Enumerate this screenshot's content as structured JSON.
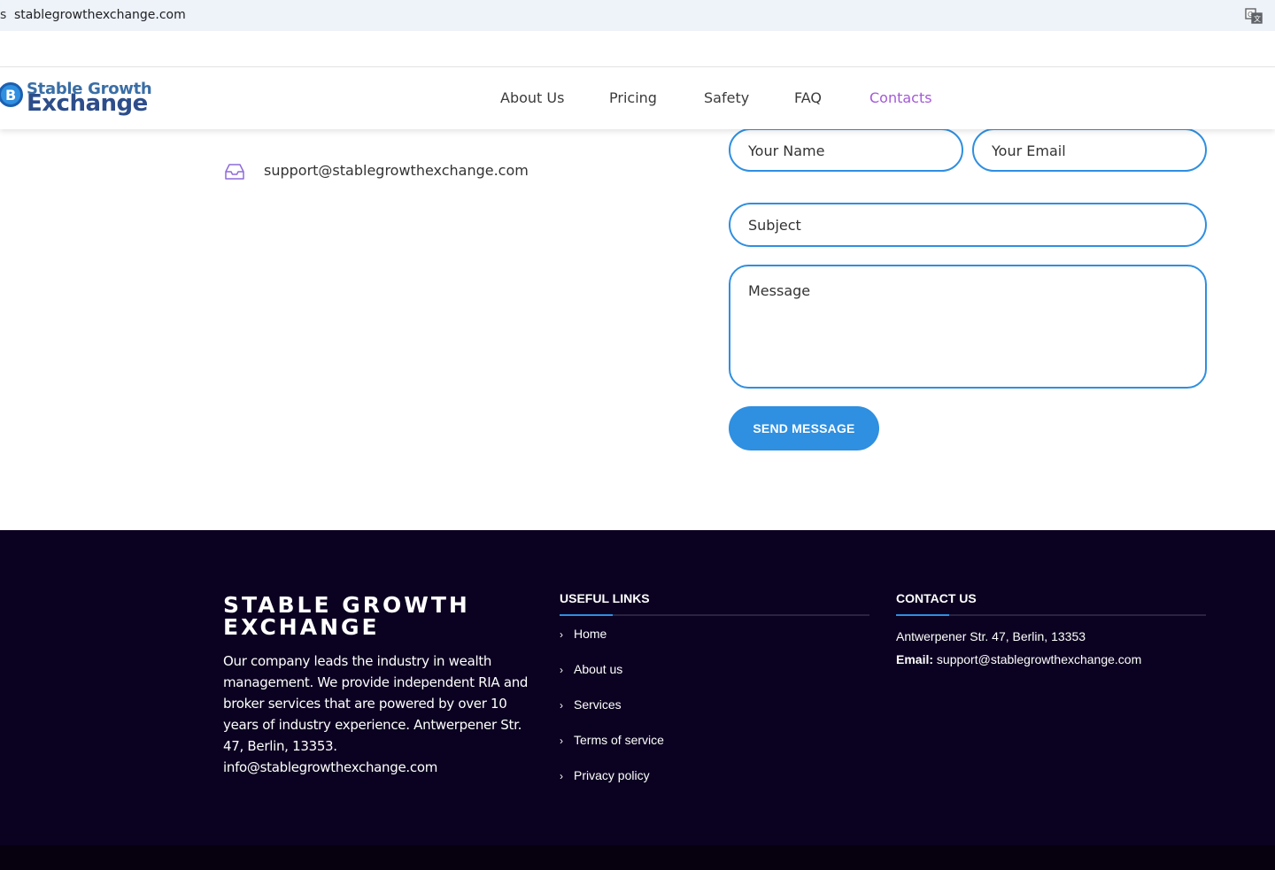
{
  "browser": {
    "url": "stablegrowthexchange.com",
    "lead_glyph": "s"
  },
  "logo": {
    "coin_glyph": "B",
    "line1": "Stable Growth",
    "line2": "Exchange"
  },
  "nav": {
    "items": [
      {
        "label": "About Us"
      },
      {
        "label": "Pricing"
      },
      {
        "label": "Safety"
      },
      {
        "label": "FAQ"
      },
      {
        "label": "Contacts"
      }
    ],
    "active_color": "#a359d6"
  },
  "contact_info": {
    "email": "support@stablegrowthexchange.com",
    "icon": "inbox-icon"
  },
  "form": {
    "name_placeholder": "Your Name",
    "email_placeholder": "Your Email",
    "subject_placeholder": "Subject",
    "message_placeholder": "Message",
    "submit_label": "SEND MESSAGE",
    "accent_color": "#2f8fe0"
  },
  "footer": {
    "brand_line1": "STABLE GROWTH",
    "brand_line2": "EXCHANGE",
    "description": "Our company leads the industry in wealth management. We provide independent RIA and broker services that are powered by over 10 years of industry experience. Antwerpener Str. 47, Berlin, 13353. info@stablegrowthexchange.com",
    "useful_links_heading": "USEFUL LINKS",
    "links": [
      {
        "label": "Home"
      },
      {
        "label": "About us"
      },
      {
        "label": "Services"
      },
      {
        "label": "Terms of service"
      },
      {
        "label": "Privacy policy"
      }
    ],
    "contact_heading": "CONTACT US",
    "address": "Antwerpener Str. 47, Berlin, 13353",
    "email_label": "Email:",
    "email_value": "support@stablegrowthexchange.com",
    "background_color": "#0b0120"
  }
}
